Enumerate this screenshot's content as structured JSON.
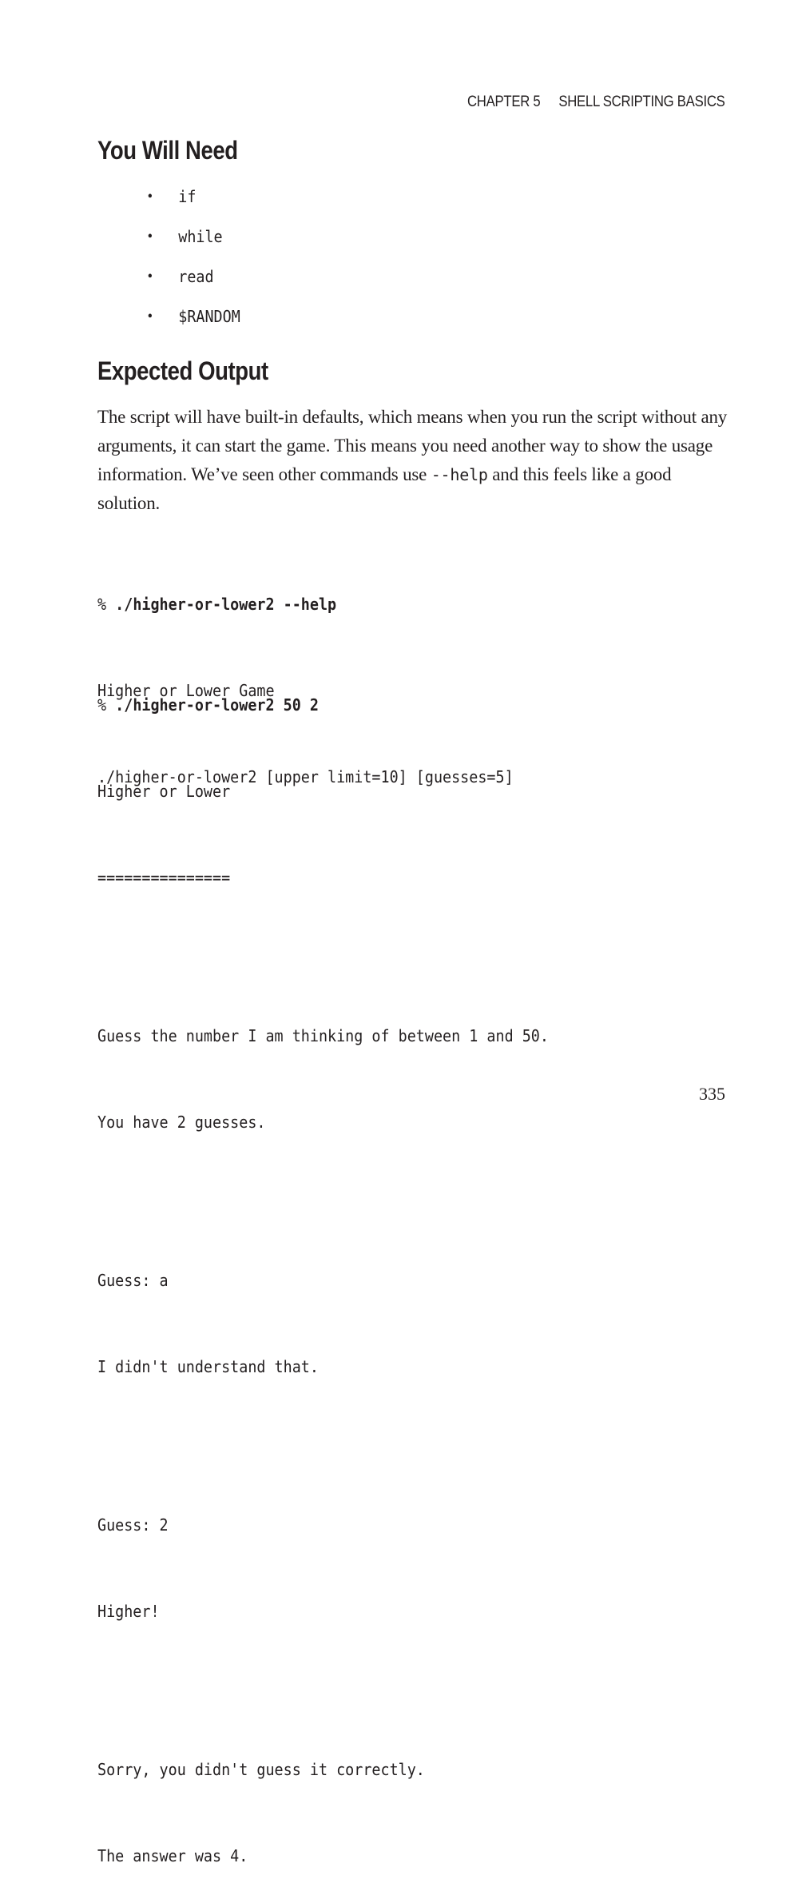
{
  "running_head": {
    "chapter": "CHAPTER 5",
    "title": "SHELL SCRIPTING BASICS"
  },
  "section_need": {
    "heading": "You Will Need",
    "items": [
      "if",
      "while",
      "read",
      "$RANDOM"
    ]
  },
  "section_output": {
    "heading": "Expected Output",
    "paragraph": {
      "before_code": "The script will have built-in defaults, which means when you run the script without any arguments, it can start the game. This means you need another way to show the usage information. We’ve seen other commands use ",
      "inline_code": "--help",
      "after_code": " and this feels like a good solution."
    },
    "example1": {
      "prompt": "% ",
      "command": "./higher-or-lower2 --help",
      "output": [
        "Higher or Lower Game",
        "./higher-or-lower2 [upper limit=10] [guesses=5]"
      ]
    },
    "example2": {
      "prompt": "% ",
      "command": "./higher-or-lower2 50 2",
      "header": [
        "Higher or Lower",
        "==============="
      ],
      "intro": [
        "Guess the number I am thinking of between 1 and 50.",
        "You have 2 guesses."
      ],
      "guess1": [
        "Guess: a",
        "I didn't understand that."
      ],
      "guess2": [
        "Guess: 2",
        "Higher!"
      ],
      "result": [
        "Sorry, you didn't guess it correctly.",
        "The answer was 4."
      ]
    }
  },
  "page_number": "335"
}
